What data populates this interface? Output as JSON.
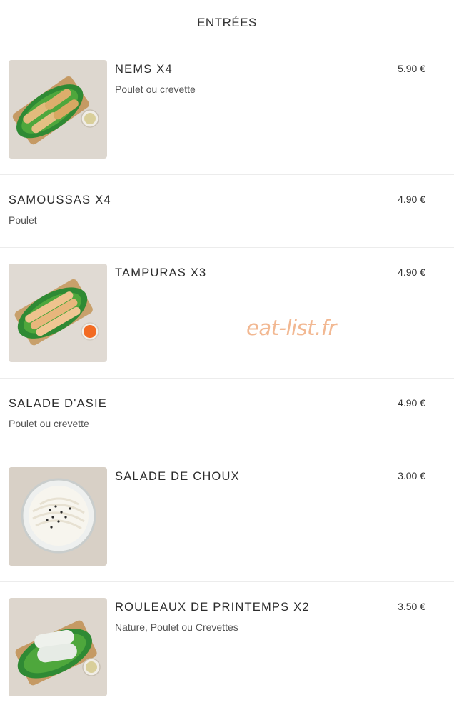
{
  "header": {
    "title": "ENTRÉES"
  },
  "items": [
    {
      "name": "NEMS X4",
      "desc": "Poulet ou crevette",
      "price": "5.90 €"
    },
    {
      "name": "SAMOUSSAS X4",
      "desc": "Poulet",
      "price": "4.90 €"
    },
    {
      "name": "TAMPURAS X3",
      "desc": "",
      "price": "4.90 €"
    },
    {
      "name": "SALADE D'ASIE",
      "desc": "Poulet ou crevette",
      "price": "4.90 €"
    },
    {
      "name": "SALADE DE CHOUX",
      "desc": "",
      "price": "3.00 €"
    },
    {
      "name": "ROULEAUX DE PRINTEMPS X2",
      "desc": "Nature, Poulet ou Crevettes",
      "price": "3.50 €"
    }
  ],
  "watermark": "eat-list.fr",
  "colors": {
    "divider": "#ececec",
    "watermark": "#f2b892",
    "text": "#333333"
  }
}
